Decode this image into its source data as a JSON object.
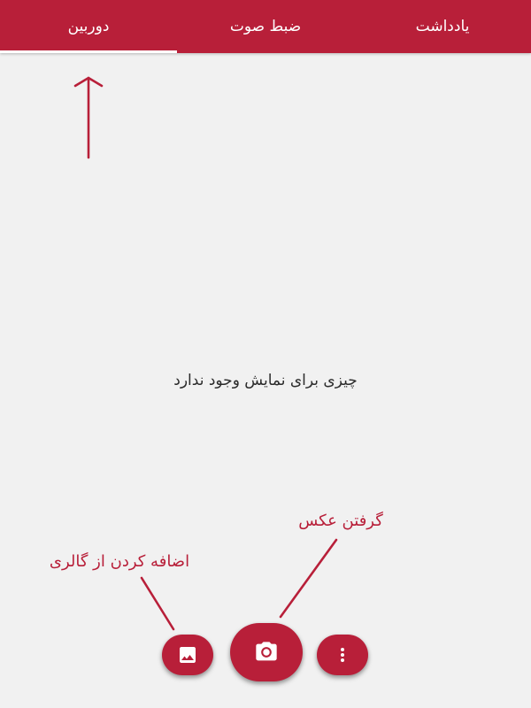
{
  "tabs": [
    {
      "label": "یادداشت",
      "active": false
    },
    {
      "label": "ضبط صوت",
      "active": false
    },
    {
      "label": "دوربین",
      "active": true
    }
  ],
  "empty_state": {
    "message": "چیزی برای نمایش وجود ندارد"
  },
  "annotations": {
    "take_photo": "گرفتن عکس",
    "add_from_gallery": "اضافه کردن از گالری"
  },
  "actions": {
    "gallery_icon": "image-icon",
    "camera_icon": "camera-icon",
    "more_icon": "more-vertical-icon"
  },
  "colors": {
    "accent": "#b81f39",
    "background": "#f1f1f1",
    "tab_text": "#ffffff"
  }
}
